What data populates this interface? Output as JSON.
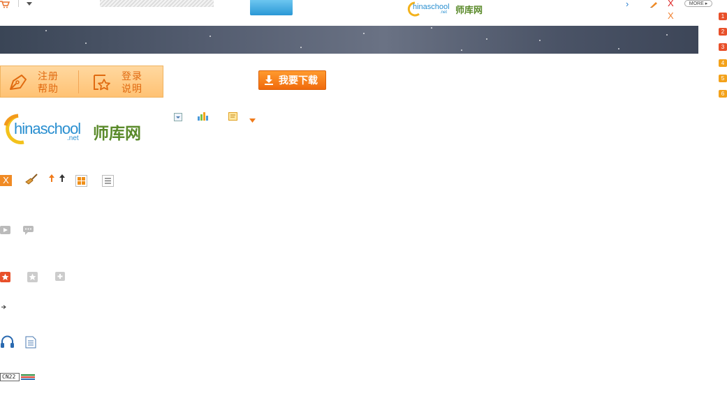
{
  "topbar": {
    "cart_icon": "cart-icon",
    "logo_text": "hinaschool",
    "logo_suffix": ".net",
    "logo_cn": "师库网",
    "close_x": "X",
    "close_x2": "X",
    "more_label": "MORE"
  },
  "ranks": [
    "1",
    "2",
    "3",
    "4",
    "5",
    "6"
  ],
  "auth": {
    "register": "注册",
    "help": "帮助",
    "login": "登录",
    "explain": "说明"
  },
  "download": {
    "label": "我要下载"
  },
  "logo_big": {
    "text": "hinaschool",
    "suffix": ".net",
    "cn": "师库网"
  },
  "toolbar2": {
    "close": "X"
  },
  "footer": {
    "cnzz": "CN22"
  },
  "colors": {
    "accent": "#f07a1a",
    "blue": "#2a98d6",
    "rank_red": "#e8502a",
    "rank_yellow": "#f3a21b"
  }
}
